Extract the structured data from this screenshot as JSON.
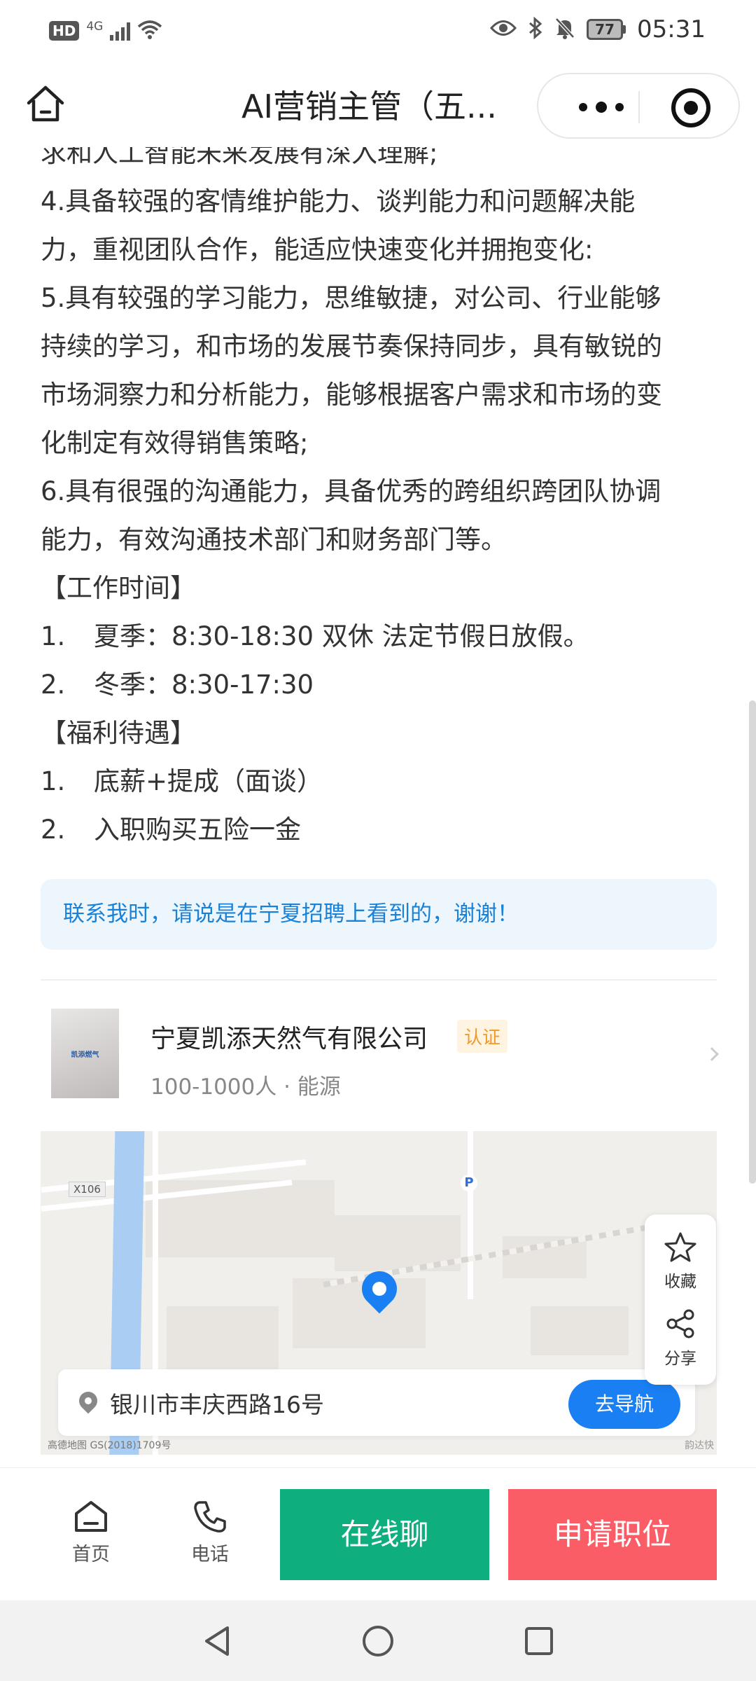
{
  "status_bar": {
    "hd": "HD",
    "network": "4G",
    "battery": "77",
    "time": "05:31"
  },
  "nav": {
    "title": "AI营销主管（五..."
  },
  "description": {
    "lines": [
      "求和人工智能未来发展有深入理解;",
      "4.具备较强的客情维护能力、谈判能力和问题解决能",
      "力，重视团队合作，能适应快速变化并拥抱变化:",
      "5.具有较强的学习能力，思维敏捷，对公司、行业能够",
      "持续的学习，和市场的发展节奏保持同步，具有敏锐的",
      "市场洞察力和分析能力，能够根据客户需求和市场的变",
      "化制定有效得销售策略;",
      "6.具有很强的沟通能力，具备优秀的跨组织跨团队协调",
      "能力，有效沟通技术部门和财务部门等。"
    ],
    "work_time_header": "【工作时间】",
    "work_time": [
      {
        "num": "1.",
        "text": "夏季：8:30-18:30   双休  法定节假日放假。"
      },
      {
        "num": "2.",
        "text": "冬季：8:30-17:30"
      }
    ],
    "benefits_header": "【福利待遇】",
    "benefits": [
      {
        "num": "1.",
        "text": "底薪+提成（面谈）"
      },
      {
        "num": "2.",
        "text": "入职购买五险一金"
      }
    ]
  },
  "tip": "联系我时，请说是在宁夏招聘上看到的，谢谢！",
  "company": {
    "name": "宁夏凯添天然气有限公司",
    "badge": "认证",
    "meta": "100-1000人 · 能源",
    "logo_text": "凯添燃气"
  },
  "map": {
    "road_code": "X106",
    "address": "银川市丰庆西路16号",
    "navigate_label": "去导航",
    "watermark": "高德地图  GS(2018)1709号",
    "watermark_right": "韵达快"
  },
  "float_panel": {
    "favorite": "收藏",
    "share": "分享"
  },
  "bottom_bar": {
    "home": "首页",
    "phone": "电话",
    "chat": "在线聊",
    "apply": "申请职位"
  },
  "colors": {
    "chat_button": "#0fae7e",
    "apply_button": "#fb5d66",
    "accent_blue": "#1a7ff2",
    "tip_text": "#1a82d6",
    "tip_bg": "#eef6fd",
    "badge": "#f09a2b"
  }
}
